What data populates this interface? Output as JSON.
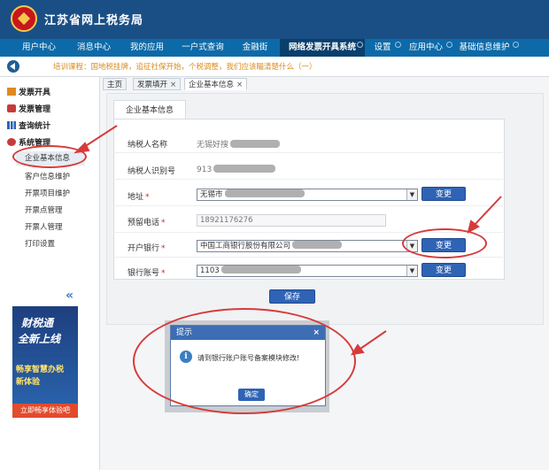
{
  "header": {
    "title": "江苏省网上税务局"
  },
  "nav": {
    "items": [
      {
        "label": "用户中心"
      },
      {
        "label": "消息中心"
      },
      {
        "label": "我的应用"
      },
      {
        "label": "一户式查询"
      },
      {
        "label": "金融街"
      },
      {
        "label": "网络发票开具系统"
      },
      {
        "label": "设置"
      },
      {
        "label": "应用中心"
      },
      {
        "label": "基础信息维护"
      }
    ],
    "active": "网络发票开具系统"
  },
  "notice": {
    "text": "培训课程：国地税挂牌，追征社保开始，个税调整，我们应该瞄清楚什么（一）"
  },
  "sidebar": {
    "groups": [
      {
        "label": "发票开具"
      },
      {
        "label": "发票管理"
      },
      {
        "label": "查询统计"
      },
      {
        "label": "系统管理"
      }
    ],
    "sub_items": [
      {
        "label": "企业基本信息"
      },
      {
        "label": "客户信息维护"
      },
      {
        "label": "开票项目维护"
      },
      {
        "label": "开票点管理"
      },
      {
        "label": "开票人管理"
      },
      {
        "label": "打印设置"
      }
    ],
    "collapse": "«"
  },
  "promo": {
    "line1": "财税通",
    "line2": "全新上线",
    "line3": "畅享智慧办税",
    "line4": "新体验",
    "cta": "立即畅享体验吧"
  },
  "tabs": [
    {
      "label": "主页",
      "closable": false
    },
    {
      "label": "发票填开",
      "closable": true
    },
    {
      "label": "企业基本信息",
      "closable": true
    }
  ],
  "tab_close": "×",
  "panel": {
    "tab_label": "企业基本信息"
  },
  "form": {
    "fields": [
      {
        "label": "纳税人名称",
        "required": false,
        "value": "无锡好搜"
      },
      {
        "label": "纳税人识别号",
        "required": false,
        "value": "913"
      },
      {
        "label": "地址",
        "required": true,
        "value": "无锡市"
      },
      {
        "label": "预留电话",
        "required": true,
        "value": "18921176276"
      },
      {
        "label": "开户银行",
        "required": true,
        "value": "中国工商银行股份有限公司"
      },
      {
        "label": "银行账号",
        "required": true,
        "value": "1103"
      }
    ],
    "required_mark": "*",
    "change_label": "变更",
    "save_label": "保存",
    "dropdown_arrow": "▼"
  },
  "dialog": {
    "title": "提示",
    "close": "×",
    "info_glyph": "i",
    "message": "请到银行账户账号备案模块修改!",
    "ok_label": "确定"
  },
  "colors": {
    "header": "#1a4f86",
    "nav": "#0d6aa8",
    "nav_active": "#0a3f6c",
    "notice_text": "#d98b1c",
    "button": "#2f63b5",
    "annotation": "#d63b3b"
  }
}
